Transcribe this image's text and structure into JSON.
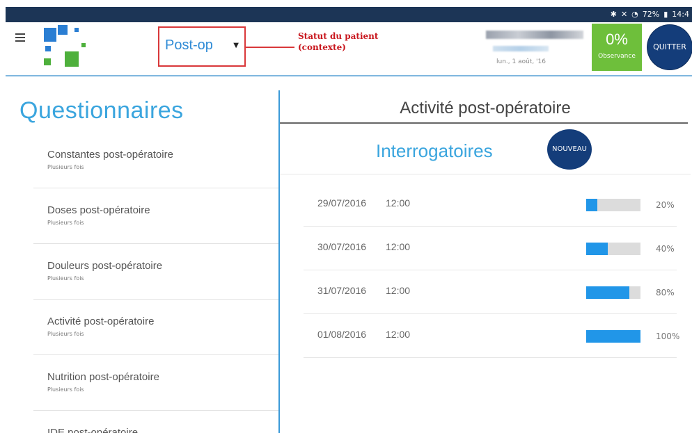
{
  "status_bar": {
    "icons": [
      "bluetooth-icon",
      "mute-icon",
      "wifi-icon",
      "battery-icon"
    ],
    "battery": "72%",
    "time": "14:4"
  },
  "header": {
    "context_value": "Post-op",
    "callout_line1": "Statut du patient",
    "callout_line2": "(contexte)",
    "date": "lun., 1 août, '16",
    "observance_value": "0%",
    "observance_label": "Observance",
    "quit_label": "QUITTER"
  },
  "questionnaires": {
    "title": "Questionnaires",
    "items": [
      {
        "name": "Constantes post-opératoire",
        "sub": "Plusieurs fois"
      },
      {
        "name": "Doses post-opératoire",
        "sub": "Plusieurs fois"
      },
      {
        "name": "Douleurs post-opératoire",
        "sub": "Plusieurs fois"
      },
      {
        "name": "Activité post-opératoire",
        "sub": "Plusieurs fois"
      },
      {
        "name": "Nutrition post-opératoire",
        "sub": "Plusieurs fois"
      },
      {
        "name": "IDE post-opératoire",
        "sub": ""
      }
    ]
  },
  "detail": {
    "title": "Activité post-opératoire",
    "section_title": "Interrogatoires",
    "new_label": "NOUVEAU",
    "rows": [
      {
        "date": "29/07/2016",
        "time": "12:00",
        "progress": 20,
        "pct": "20%"
      },
      {
        "date": "30/07/2016",
        "time": "12:00",
        "progress": 40,
        "pct": "40%"
      },
      {
        "date": "31/07/2016",
        "time": "12:00",
        "progress": 80,
        "pct": "80%"
      },
      {
        "date": "01/08/2016",
        "time": "12:00",
        "progress": 100,
        "pct": "100%"
      }
    ]
  },
  "colors": {
    "accent": "#3aa5de",
    "bar": "#2196e8",
    "observance_bg": "#6ebf3b",
    "button_bg": "#143d7a",
    "callout": "#c8161d"
  }
}
